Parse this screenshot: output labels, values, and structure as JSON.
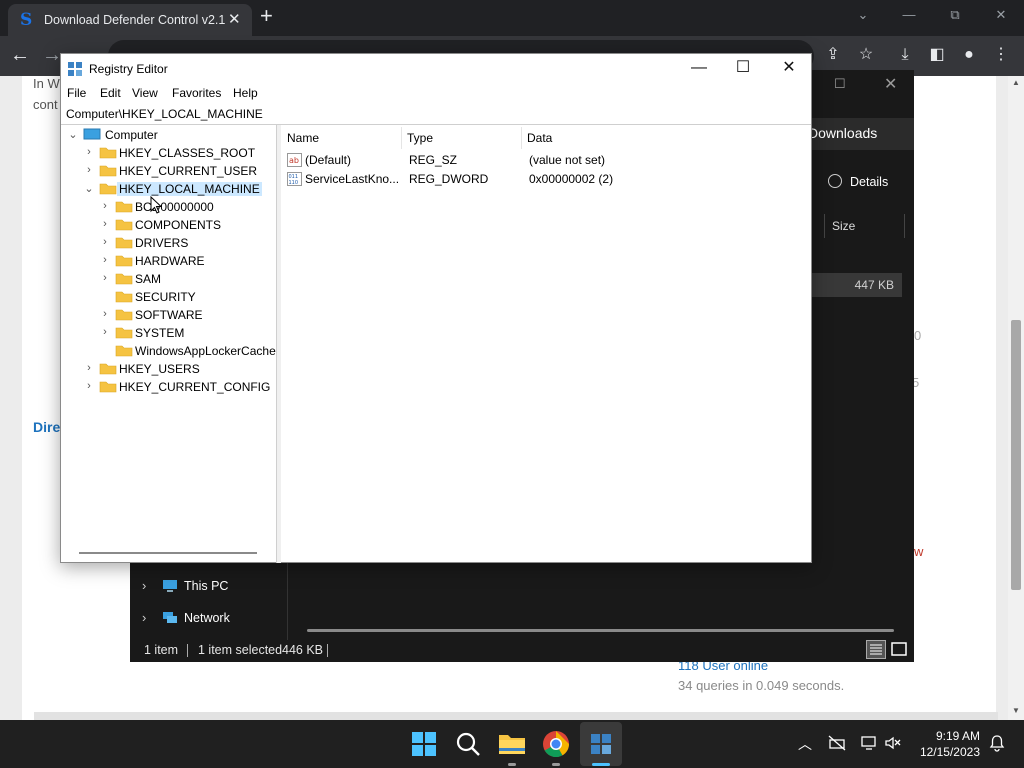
{
  "browser": {
    "tab_title": "Download Defender Control v2.1",
    "tab_close": "✕",
    "new_tab": "+",
    "win_minimize": "—",
    "win_restore": "⧉",
    "win_close": "✕",
    "back": "←",
    "forward": "→"
  },
  "webpage": {
    "text_line1": "In W",
    "text_line2": "cont",
    "link_text": "Dire",
    "users_online": "118 User online",
    "queries": "34 queries in 0.049 seconds.",
    "partial_0": "0",
    "partial_5": "5",
    "partial_w": "w"
  },
  "explorer": {
    "downloads": "Downloads",
    "details": "Details",
    "size_header": "Size",
    "file_size": "447 KB",
    "nav_items": [
      {
        "label": "This PC"
      },
      {
        "label": "Network"
      }
    ],
    "status_items": "1 item",
    "status_selected": "1 item selected",
    "status_size": "446 KB"
  },
  "regedit": {
    "title": "Registry Editor",
    "menu": [
      "File",
      "Edit",
      "View",
      "Favorites",
      "Help"
    ],
    "address": "Computer\\HKEY_LOCAL_MACHINE",
    "tree": {
      "root": "Computer",
      "hkcr": "HKEY_CLASSES_ROOT",
      "hkcu": "HKEY_CURRENT_USER",
      "hklm": "HKEY_LOCAL_MACHINE",
      "hklm_children": [
        "BCD00000000",
        "COMPONENTS",
        "DRIVERS",
        "HARDWARE",
        "SAM",
        "SECURITY",
        "SOFTWARE",
        "SYSTEM",
        "WindowsAppLockerCache"
      ],
      "hku": "HKEY_USERS",
      "hkcc": "HKEY_CURRENT_CONFIG"
    },
    "columns": {
      "name": "Name",
      "type": "Type",
      "data": "Data"
    },
    "values": [
      {
        "name": "(Default)",
        "type": "REG_SZ",
        "data": "(value not set)"
      },
      {
        "name": "ServiceLastKno...",
        "type": "REG_DWORD",
        "data": "0x00000002 (2)"
      }
    ]
  },
  "taskbar": {
    "time": "9:19 AM",
    "date": "12/15/2023"
  },
  "colors": {
    "selection": "#cce8ff",
    "folder": "#f5c342",
    "link": "#1e73be"
  }
}
